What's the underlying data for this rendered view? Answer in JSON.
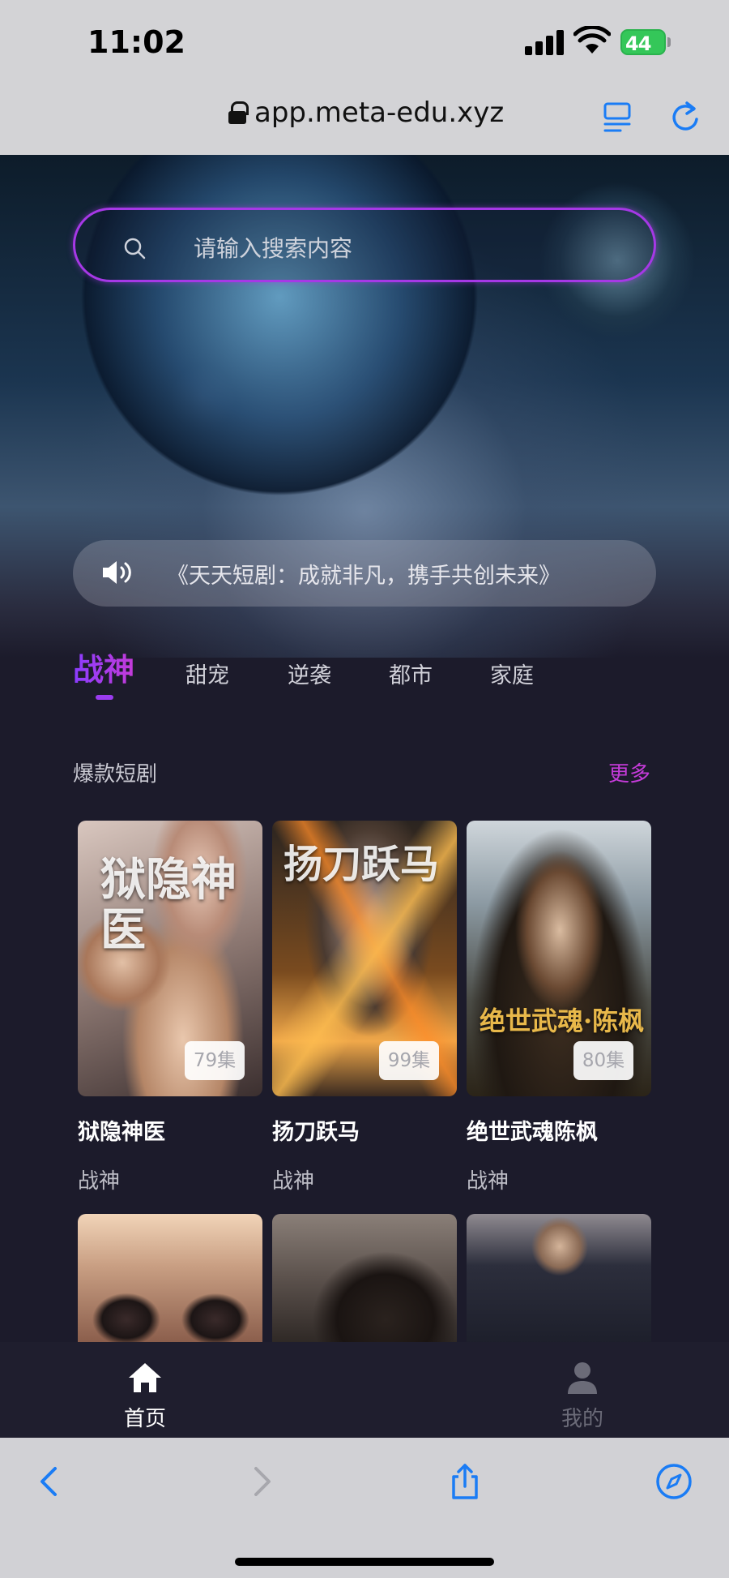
{
  "status_bar": {
    "time": "11:02",
    "battery": "44"
  },
  "browser": {
    "url": "app.meta-edu.xyz"
  },
  "search": {
    "placeholder": "请输入搜索内容"
  },
  "notice": {
    "text": "《天天短剧：成就非凡，携手共创未来》"
  },
  "tabs": [
    {
      "label": "战神",
      "active": true
    },
    {
      "label": "甜宠",
      "active": false
    },
    {
      "label": "逆袭",
      "active": false
    },
    {
      "label": "都市",
      "active": false
    },
    {
      "label": "家庭",
      "active": false
    }
  ],
  "section": {
    "title": "爆款短剧",
    "more": "更多"
  },
  "dramas": [
    {
      "title": "狱隐神医",
      "tag": "战神",
      "episodes": "79集",
      "poster_art": "狱隐神医"
    },
    {
      "title": "扬刀跃马",
      "tag": "战神",
      "episodes": "99集",
      "poster_art": "扬刀跃马"
    },
    {
      "title": "绝世武魂陈枫",
      "tag": "战神",
      "episodes": "80集",
      "poster_art": "绝世武魂·陈枫"
    }
  ],
  "bottom_nav": {
    "home": "首页",
    "mine": "我的"
  },
  "colors": {
    "accent": "#a638e6",
    "background": "#1c1b2b",
    "ios_blue": "#1a7cf5"
  }
}
